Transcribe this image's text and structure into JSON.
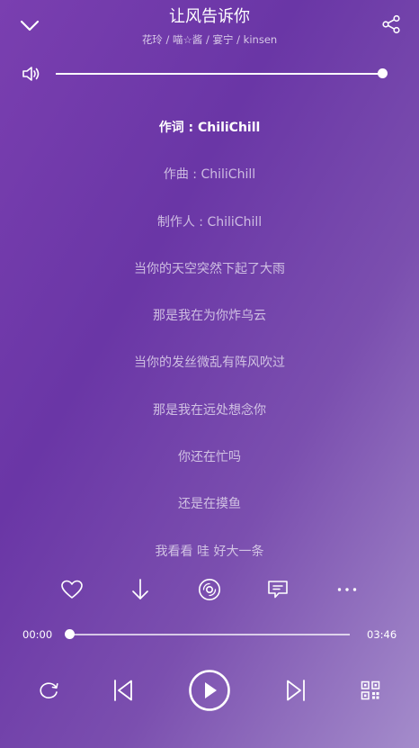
{
  "header": {
    "title": "让风告诉你",
    "artists": "花玲 / 喵☆酱 / 宴宁 / kinsen",
    "back_icon": "chevron-down-icon",
    "share_icon": "share-icon"
  },
  "volume": {
    "icon": "speaker-icon",
    "level": 1.0
  },
  "lyrics": [
    "作词 : ChiliChill",
    "作曲 : ChiliChill",
    "制作人 : ChiliChill",
    "当你的天空突然下起了大雨",
    "那是我在为你炸乌云",
    "当你的发丝微乱有阵风吹过",
    "那是我在远处想念你",
    "你还在忙吗",
    "还是在摸鱼",
    "我看看 哇 好大一条"
  ],
  "active_lyric_index": 0,
  "actions": {
    "like_icon": "heart-icon",
    "download_icon": "download-icon",
    "disc_icon": "vinyl-disc-icon",
    "comment_icon": "comment-icon",
    "more_icon": "more-icon"
  },
  "progress": {
    "current": "00:00",
    "total": "03:46",
    "fraction": 0.0
  },
  "controls": {
    "repeat_icon": "repeat-icon",
    "prev_icon": "previous-icon",
    "play_icon": "play-icon",
    "next_icon": "next-icon",
    "playlist_icon": "qr-playlist-icon"
  },
  "colors": {
    "gradient_start": "#7a3fb0",
    "gradient_end": "#a48ccb",
    "text_primary": "#ffffff"
  }
}
